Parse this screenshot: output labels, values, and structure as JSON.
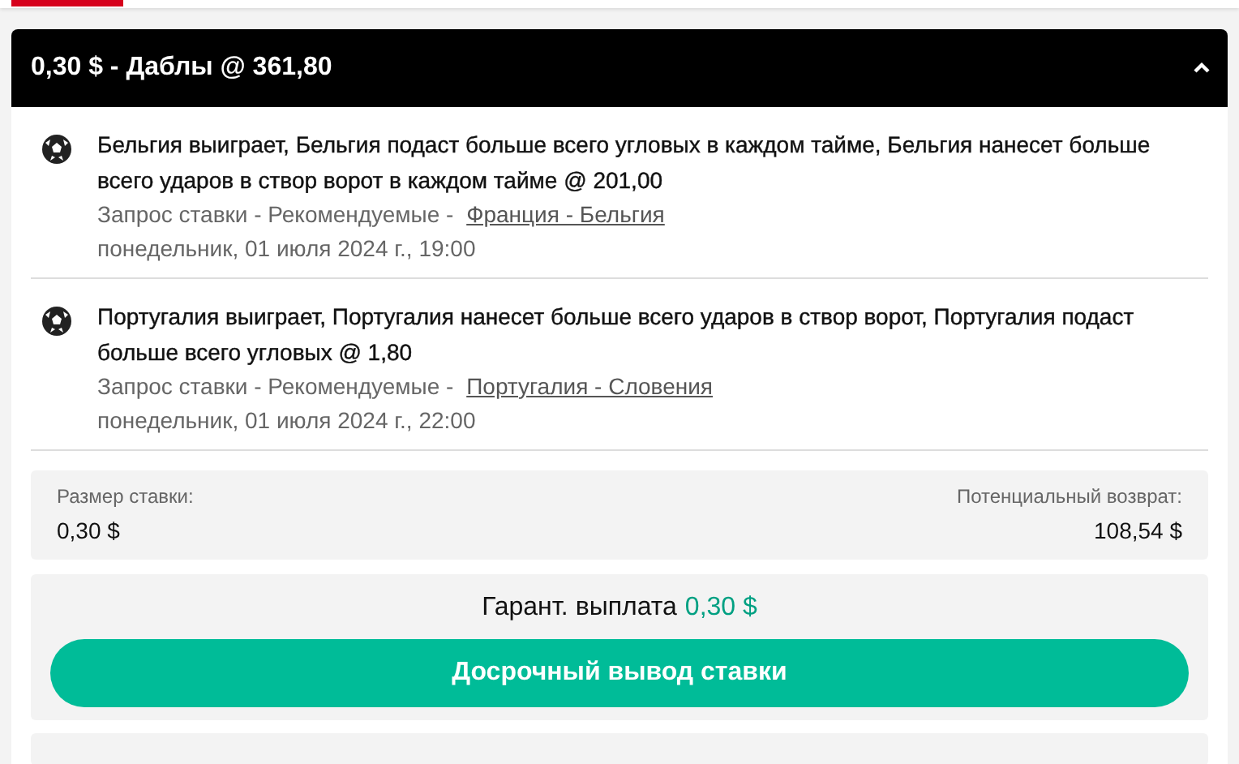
{
  "bet": {
    "title": "0,30 $ - Даблы @ 361,80",
    "expanded": true,
    "selections": [
      {
        "text": "Бельгия выиграет, Бельгия подаст больше всего угловых в каждом тайме, Бельгия нанесет больше всего ударов в створ ворот в каждом тайме @ 201,00",
        "source": "Запрос ставки - Рекомендуемые - ",
        "match": "Франция - Бельгия",
        "date": "понедельник, 01 июля 2024 г., 19:00"
      },
      {
        "text": "Португалия выиграет, Португалия нанесет больше всего ударов в створ ворот, Португалия подаст больше всего угловых @ 1,80",
        "source": "Запрос ставки - Рекомендуемые - ",
        "match": "Португалия - Словения",
        "date": "понедельник, 01 июля 2024 г., 22:00"
      }
    ],
    "stake": {
      "label": "Размер ставки:",
      "value": "0,30 $"
    },
    "return": {
      "label": "Потенциальный возврат:",
      "value": "108,54 $"
    },
    "guaranteed": {
      "label": "Гарант. выплата",
      "value": "0,30 $"
    },
    "cashout_button": "Досрочный вывод ставки"
  }
}
